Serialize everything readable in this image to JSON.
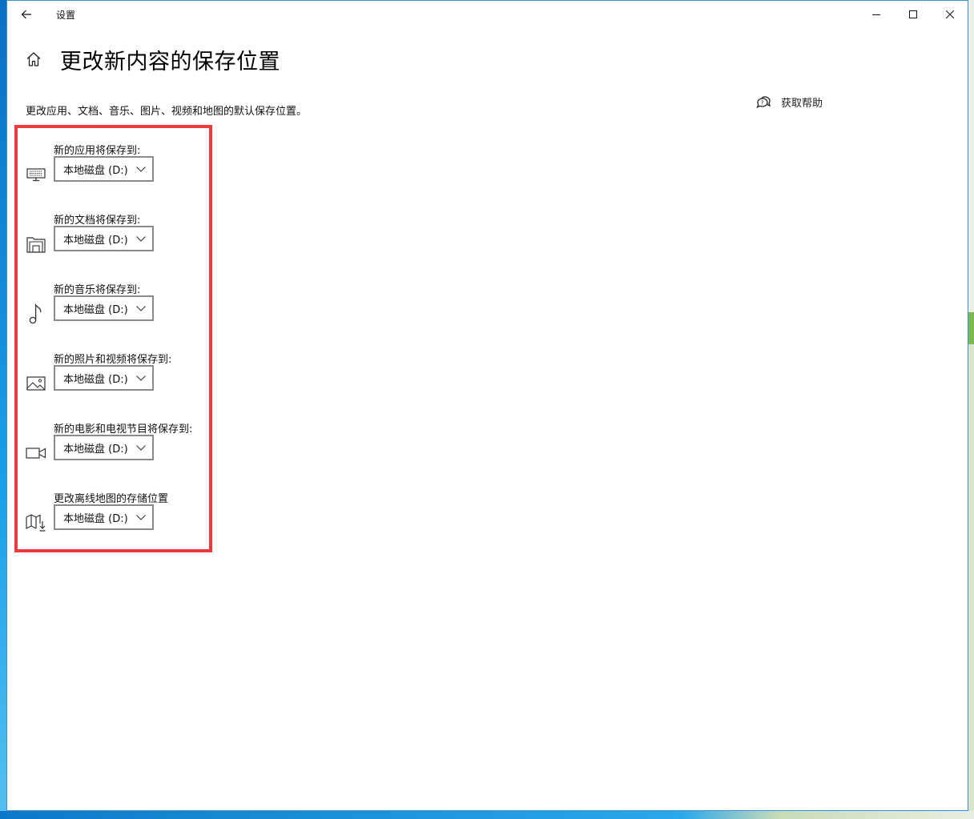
{
  "window": {
    "title": "设置",
    "controls": [
      "minimize",
      "maximize",
      "close"
    ]
  },
  "page": {
    "title": "更改新内容的保存位置",
    "description": "更改应用、文档、音乐、图片、视频和地图的默认保存位置。",
    "help_label": "获取帮助"
  },
  "settings": [
    {
      "label": "新的应用将保存到:",
      "icon": "monitor-keyboard-icon",
      "value": "本地磁盘 (D:)"
    },
    {
      "label": "新的文档将保存到:",
      "icon": "document-folder-icon",
      "value": "本地磁盘 (D:)"
    },
    {
      "label": "新的音乐将保存到:",
      "icon": "music-note-icon",
      "value": "本地磁盘 (D:)"
    },
    {
      "label": "新的照片和视频将保存到:",
      "icon": "picture-icon",
      "value": "本地磁盘 (D:)"
    },
    {
      "label": "新的电影和电视节目将保存到:",
      "icon": "video-camera-icon",
      "value": "本地磁盘 (D:)"
    },
    {
      "label": "更改离线地图的存储位置",
      "icon": "map-download-icon",
      "value": "本地磁盘 (D:)"
    }
  ],
  "colors": {
    "highlight_border": "#ec3a3d",
    "desktop_blue": "#1a8fd6"
  }
}
